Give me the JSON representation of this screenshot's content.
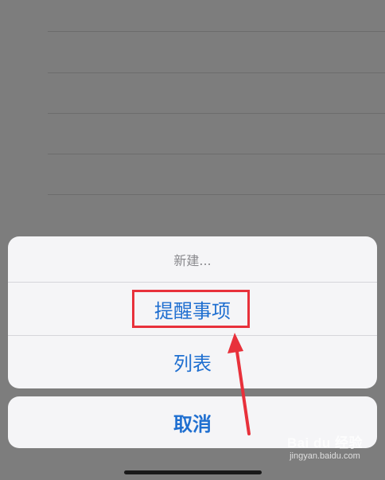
{
  "action_sheet": {
    "title": "新建...",
    "options": [
      {
        "label": "提醒事项"
      },
      {
        "label": "列表"
      }
    ],
    "cancel_label": "取消"
  },
  "annotation": {
    "highlighted_option": "提醒事项",
    "color": "#e8313b"
  },
  "watermark": {
    "brand": "Bai du 经验",
    "url": "jingyan.baidu.com"
  },
  "colors": {
    "accent": "#1f6fd0",
    "dim_overlay": "#7d7d7d",
    "sheet_bg": "#f5f5f7"
  }
}
